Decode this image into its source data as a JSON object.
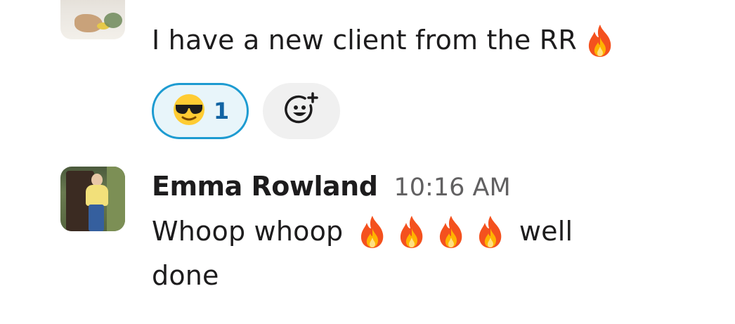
{
  "prev_message": {
    "text": "I have a new client from the RR",
    "trailing_emoji": "fire",
    "reactions": [
      {
        "emoji": "smiling-face-with-sunglasses",
        "count": "1",
        "selected": true
      }
    ],
    "add_reaction_icon": "add-emoji-icon"
  },
  "message": {
    "author": "Emma Rowland",
    "timestamp": "10:16 AM",
    "text_before": "Whoop whoop",
    "emoji_sequence": [
      "fire",
      "fire",
      "fire",
      "fire"
    ],
    "text_after": "well",
    "text_line2": "done"
  },
  "colors": {
    "accent": "#1d9bd1",
    "reaction_bg": "#e8f5fa",
    "count_text": "#1264a3",
    "timestamp": "#616061",
    "add_reaction_bg": "#f0f0f0"
  }
}
